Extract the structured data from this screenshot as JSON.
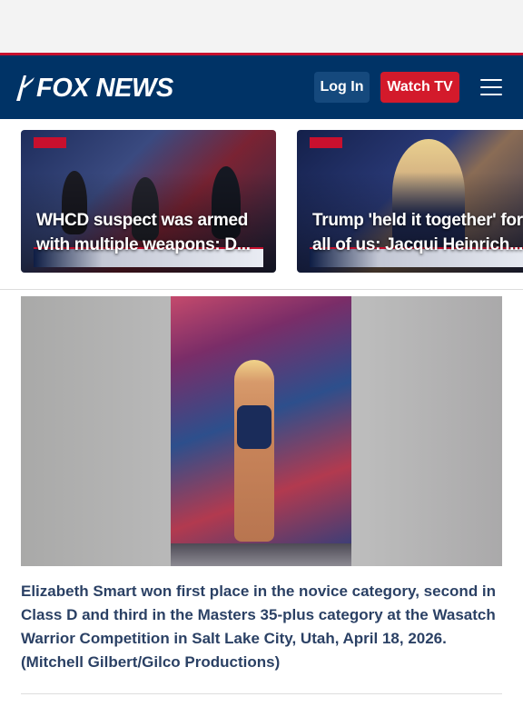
{
  "header": {
    "logo_text": "FOX NEWS",
    "login_label": "Log In",
    "watch_label": "Watch TV",
    "menu_icon": "hamburger-menu-icon",
    "colors": {
      "bar": "#003366",
      "accent": "#c8102e",
      "watch": "#d31a2b",
      "login": "#15497d"
    }
  },
  "carousel": {
    "cards": [
      {
        "title_line1": "WHCD suspect was armed",
        "title_line2": "with multiple weapons: D..."
      },
      {
        "title_line1": "Trump 'held it together' for",
        "title_line2": "all of us: Jacqui Heinrich..."
      }
    ]
  },
  "article": {
    "image_caption": "Elizabeth Smart won first place in the novice category, second in Class D and third in the Masters 35-plus category at the Wasatch Warrior Competition in Salt Lake City, Utah, April 18, 2026. (Mitchell Gilbert/Gilco Productions)",
    "text_color": "#183057"
  }
}
